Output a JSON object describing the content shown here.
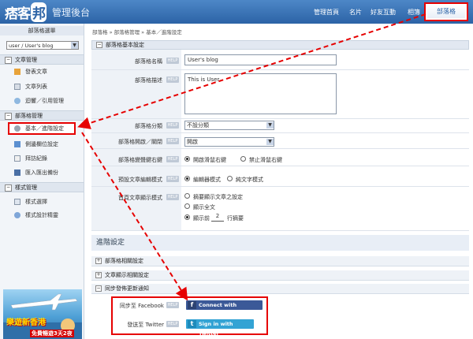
{
  "header": {
    "logo": "痞客",
    "logo_badge": "邦",
    "subtitle": "管理後台",
    "nav": [
      "管理首頁",
      "名片",
      "好友互動",
      "相簿"
    ],
    "blog_button": "部落格"
  },
  "sidebar": {
    "title": "部落格選單",
    "selected_blog": "user / User's blog",
    "sections": [
      {
        "title": "文章管理",
        "items": [
          "發表文章",
          "文章列表",
          "迴響／引用管理"
        ]
      },
      {
        "title": "部落格管理",
        "items": [
          "基本／進階設定",
          "側邊欄位設定",
          "拜訪紀錄",
          "匯入匯出備份"
        ]
      },
      {
        "title": "樣式管理",
        "items": [
          "樣式選擇",
          "樣式設計精靈"
        ]
      }
    ],
    "ad": {
      "headline": "樂遊新香港",
      "tag": "免費暢遊3天2夜"
    }
  },
  "breadcrumb": "部落格 » 部落格管理 » 基本／進階設定",
  "basic": {
    "title": "部落格基本設定",
    "help": "HELP",
    "name_label": "部落格名稱",
    "name_value": "User's blog",
    "desc_label": "部落格描述",
    "desc_value": "This is User",
    "category_label": "部落格分類",
    "category_value": "不設分類",
    "open_label": "部落格開啟／關閉",
    "open_value": "開啟",
    "rightclick_label": "部落格變聲鍵右鍵",
    "rightclick_options": [
      "開啟滑鼠右鍵",
      "禁止滑鼠右鍵"
    ],
    "editor_label": "預設文章編輯模式",
    "editor_options": [
      "編輯器模式",
      "純文字模式"
    ],
    "home_label": "首頁文章顯示模式",
    "home_options": [
      "摘要顯示文章之設定",
      "顯示全文"
    ],
    "home_show_prefix": "顯示前",
    "home_show_value": "2",
    "home_show_suffix": "行摘要"
  },
  "advanced": {
    "title": "進階設定",
    "sections": [
      "部落格相關設定",
      "文章顯示相關設定",
      "同步發佈更新通知"
    ],
    "facebook_label": "同步至 Facebook",
    "facebook_button": "Connect with Facebook",
    "twitter_label": "發送至 Twitter",
    "twitter_button": "Sign in with Twitter"
  }
}
